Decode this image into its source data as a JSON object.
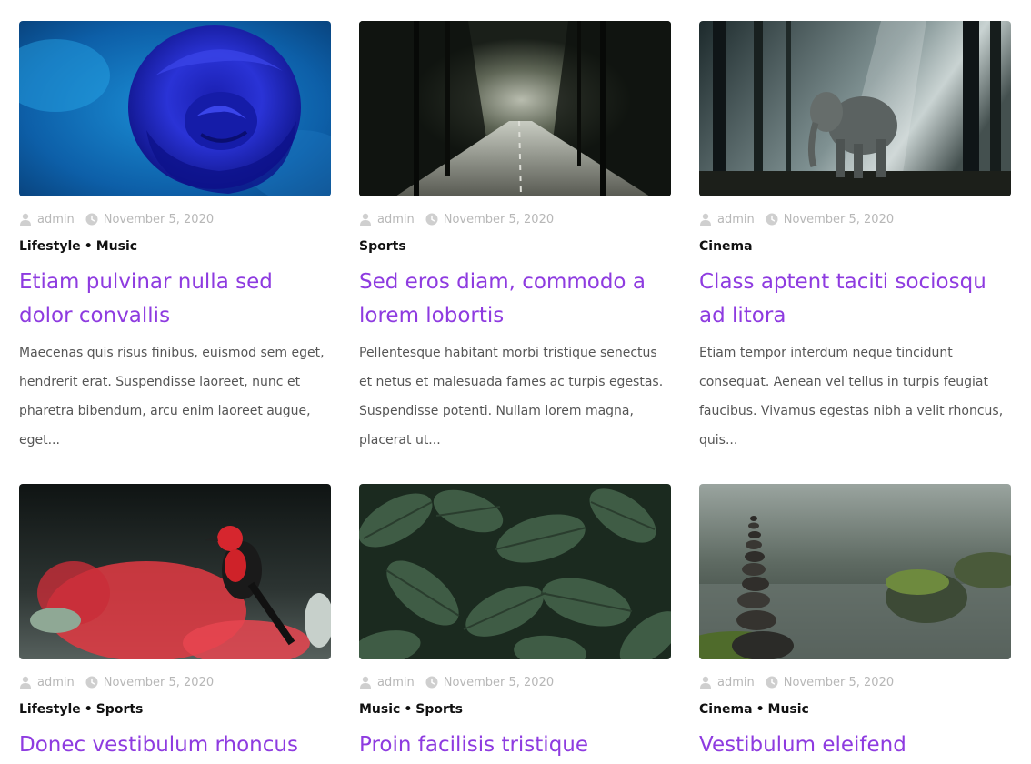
{
  "posts": [
    {
      "image": "blue-rose",
      "author": "admin",
      "date": "November 5, 2020",
      "categories": [
        "Lifestyle",
        "Music"
      ],
      "title": "Etiam pulvinar nulla sed dolor convallis",
      "excerpt": "Maecenas quis risus finibus, euismod sem eget, hendrerit erat. Suspendisse laoreet, nunc et pharetra bibendum, arcu enim laoreet augue, eget..."
    },
    {
      "image": "forest-road",
      "author": "admin",
      "date": "November 5, 2020",
      "categories": [
        "Sports"
      ],
      "title": "Sed eros diam, commodo a lorem lobortis",
      "excerpt": "Pellentesque habitant morbi tristique senectus et netus et malesuada fames ac turpis egestas. Suspendisse potenti. Nullam lorem magna, placerat ut..."
    },
    {
      "image": "elephant-forest",
      "author": "admin",
      "date": "November 5, 2020",
      "categories": [
        "Cinema"
      ],
      "title": "Class aptent taciti sociosqu ad litora",
      "excerpt": "Etiam tempor interdum neque tincidunt consequat. Aenean vel tellus in turpis feugiat faucibus. Vivamus egestas nibh a velit rhoncus, quis..."
    },
    {
      "image": "red-bird-flowers",
      "author": "admin",
      "date": "November 5, 2020",
      "categories": [
        "Lifestyle",
        "Sports"
      ],
      "title": "Donec vestibulum rhoncus",
      "excerpt": ""
    },
    {
      "image": "green-leaves",
      "author": "admin",
      "date": "November 5, 2020",
      "categories": [
        "Music",
        "Sports"
      ],
      "title": "Proin facilisis tristique",
      "excerpt": ""
    },
    {
      "image": "stacked-stones",
      "author": "admin",
      "date": "November 5, 2020",
      "categories": [
        "Cinema",
        "Music"
      ],
      "title": "Vestibulum eleifend",
      "excerpt": ""
    }
  ],
  "colors": {
    "title": "#8e3be0",
    "meta": "#b7b7b7",
    "category": "#111111",
    "excerpt": "#555555"
  },
  "icons": {
    "author": "user-icon",
    "date": "clock-icon"
  }
}
